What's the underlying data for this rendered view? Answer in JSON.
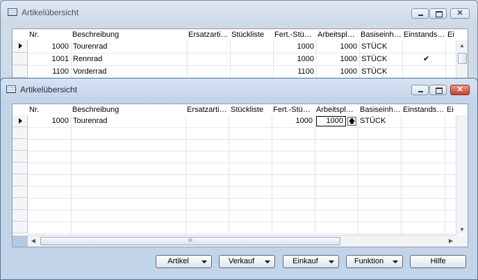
{
  "back_window": {
    "title": "Artikelübersicht",
    "columns": [
      "Nr.",
      "Beschreibung",
      "Ersatzarti…",
      "Stückliste",
      "Fert.-Stü…",
      "Arbeitspl…",
      "Basiseinh…",
      "Einstands…",
      "Ei"
    ],
    "rows": [
      {
        "nr": "1000",
        "beschreibung": "Tourenrad",
        "fert": "1000",
        "arbeitspl": "1000",
        "basis": "STÜCK",
        "einstands": ""
      },
      {
        "nr": "1001",
        "beschreibung": "Rennrad",
        "fert": "1000",
        "arbeitspl": "1000",
        "basis": "STÜCK",
        "einstands": "✔"
      },
      {
        "nr": "1100",
        "beschreibung": "Vorderrad",
        "fert": "1100",
        "arbeitspl": "1000",
        "basis": "STÜCK",
        "einstands": ""
      }
    ]
  },
  "front_window": {
    "title": "Artikelübersicht",
    "columns": [
      "Nr.",
      "Beschreibung",
      "Ersatzarti…",
      "Stückliste",
      "Fert.-Stü…",
      "Arbeitspl…",
      "Basiseinh…",
      "Einstands…",
      "Ei"
    ],
    "rows": [
      {
        "nr": "1000",
        "beschreibung": "Tourenrad",
        "fert": "1000",
        "arbeitspl": "1000",
        "basis": "STÜCK"
      }
    ],
    "scroll_grip": "III",
    "buttons": {
      "artikel": "Artikel",
      "verkauf": "Verkauf",
      "einkauf": "Einkauf",
      "funktion": "Funktion",
      "hilfe": "Hilfe"
    }
  },
  "icons": {
    "window": "table-icon",
    "minimize": "minimize-icon",
    "maximize": "maximize-icon",
    "close": "close-icon",
    "lookup": "lookup-arrow-icon"
  },
  "colors": {
    "close_button": "#c4432c",
    "grid_background": "#ffffff",
    "window_frame": "#c4d4e8"
  }
}
